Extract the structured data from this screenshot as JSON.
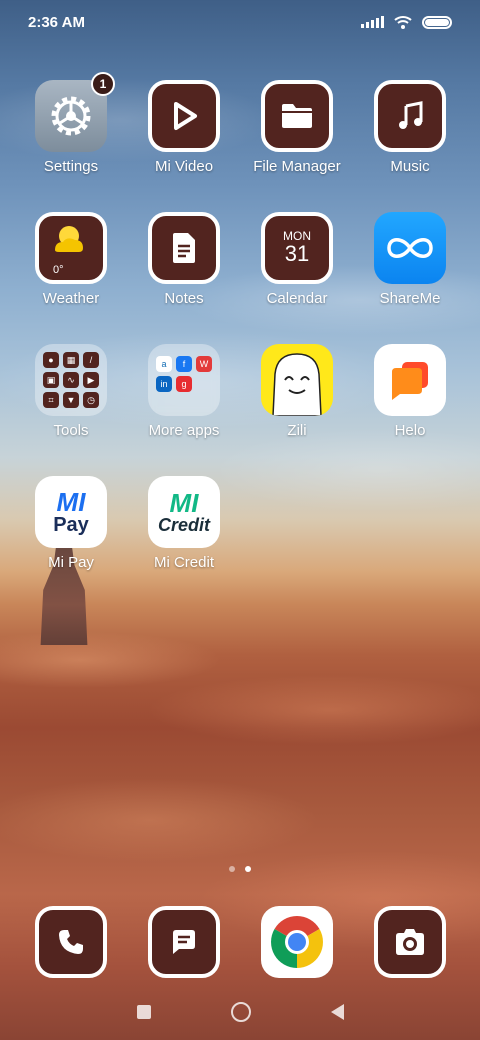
{
  "status_bar": {
    "time": "2:36 AM"
  },
  "apps": {
    "settings": {
      "label": "Settings",
      "badge": "1"
    },
    "mi_video": {
      "label": "Mi Video"
    },
    "file_manager": {
      "label": "File Manager"
    },
    "music": {
      "label": "Music"
    },
    "weather": {
      "label": "Weather",
      "temp": "0°"
    },
    "notes": {
      "label": "Notes"
    },
    "calendar": {
      "label": "Calendar",
      "month": "MON",
      "day": "31"
    },
    "shareme": {
      "label": "ShareMe"
    },
    "tools": {
      "label": "Tools"
    },
    "more_apps": {
      "label": "More apps"
    },
    "zili": {
      "label": "Zili"
    },
    "helo": {
      "label": "Helo"
    },
    "mi_pay": {
      "label": "Mi Pay",
      "logo_mi": "MI",
      "logo_text": "Pay"
    },
    "mi_credit": {
      "label": "Mi Credit",
      "logo_mi": "MI",
      "logo_text": "Credit"
    }
  },
  "page_indicator": {
    "pages": 2,
    "active": 2
  },
  "colors": {
    "icon_bg": "#52241f",
    "mi_pay_blue": "#1c6ff0",
    "mi_credit_green": "#12b886"
  },
  "dock": [
    "phone-icon",
    "messages-icon",
    "chrome-icon",
    "camera-icon"
  ],
  "nav_bar": [
    "recents-button",
    "home-button",
    "back-button"
  ]
}
